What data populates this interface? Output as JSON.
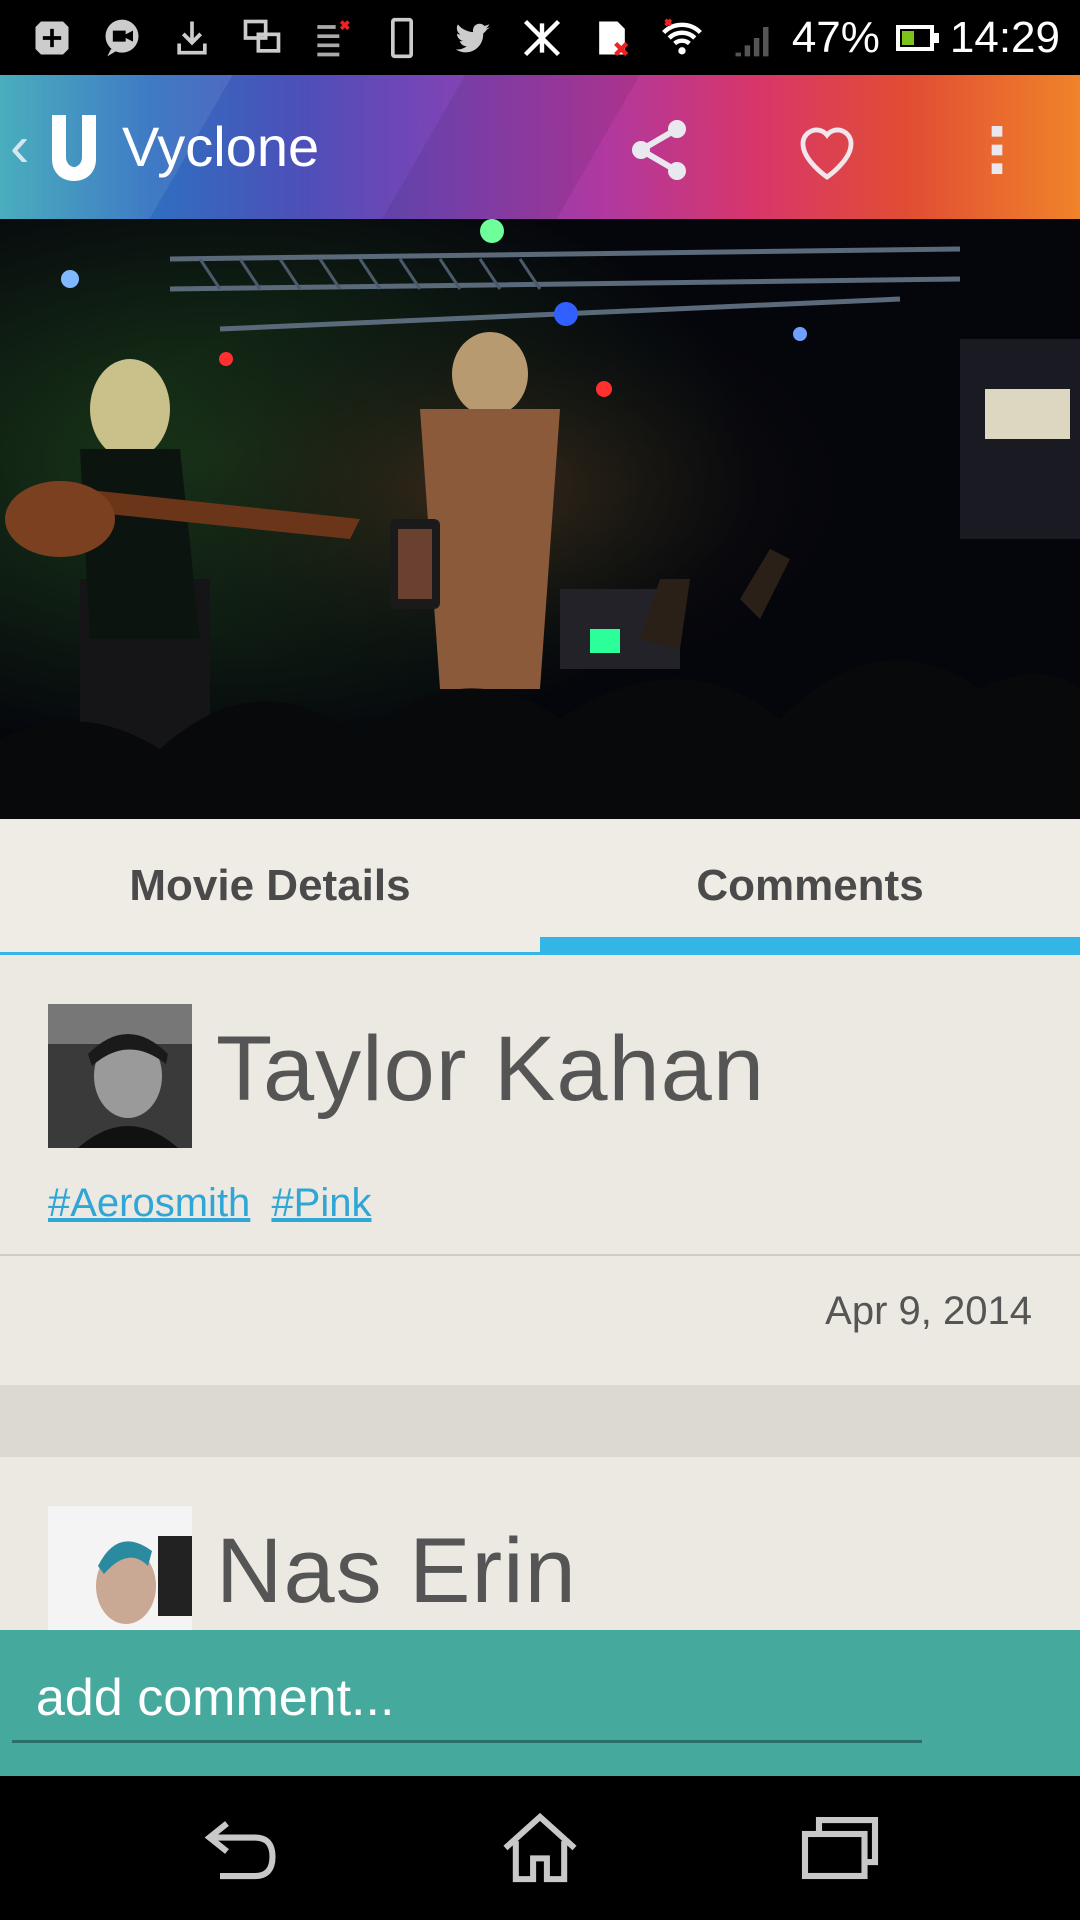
{
  "status_bar": {
    "icons": [
      "add-icon",
      "video-call-icon",
      "download-icon",
      "screens-icon",
      "list-icon",
      "phone-icon",
      "twitter-icon",
      "no-signal-icon",
      "sim-icon",
      "wifi-icon",
      "signal-icon"
    ],
    "battery": "47%",
    "battery_level": 0.47,
    "time": "14:29"
  },
  "app_bar": {
    "title": "Vyclone",
    "gradient": [
      "#3aa7b8",
      "#2f6fc0",
      "#7f43b5",
      "#d8366a",
      "#f0832a"
    ],
    "actions": [
      "share-icon",
      "heart-icon",
      "overflow-menu-icon"
    ]
  },
  "tabs": {
    "items": [
      {
        "label": "Movie Details",
        "selected": false
      },
      {
        "label": "Comments",
        "selected": true
      }
    ],
    "indicator_color": "#33b5e5"
  },
  "comments": [
    {
      "author": "Taylor Kahan",
      "tags": [
        "#Aerosmith",
        "#Pink"
      ],
      "date": "Apr 9, 2014"
    },
    {
      "author": "Nas Erin"
    }
  ],
  "add_comment": {
    "placeholder": "add comment...",
    "bar_color": "#45a99e"
  },
  "nav_bar": {
    "buttons": [
      "back-icon",
      "home-icon",
      "recent-apps-icon"
    ]
  }
}
